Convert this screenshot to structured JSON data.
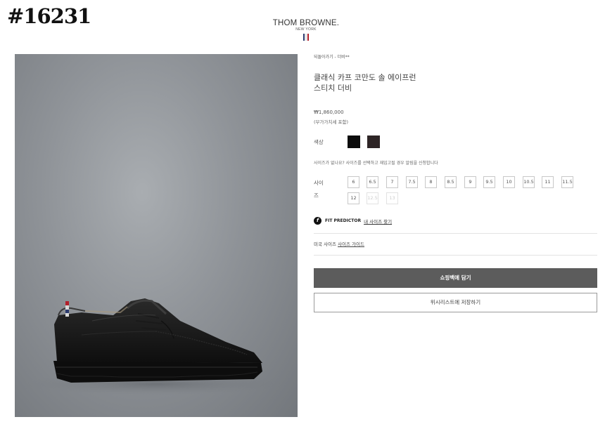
{
  "watermark": "#16231",
  "header": {
    "brand_name": "THOM BROWNE.",
    "brand_sub": "NEW YORK",
    "flag_colors": [
      "#2b3a6e",
      "#ffffff",
      "#b2202b"
    ]
  },
  "breadcrumb": "되돌아가기 - 더비**",
  "product": {
    "title_line1": "클래식 카프 코만도 솔 에이프런",
    "title_line2": "스티치 더비",
    "price": "₩1,860,000",
    "tax_note": "(부가가치세 포함)"
  },
  "colors": {
    "label": "색상",
    "swatches": [
      {
        "name": "black",
        "hex": "#0c0c0c"
      },
      {
        "name": "dark-brown",
        "hex": "#2e2526"
      }
    ]
  },
  "size_note": "사이즈가 없나요? 사이즈를 선택하고 재입고될 경우 알림을 신청합니다",
  "sizes": {
    "label": "사이즈",
    "options": [
      {
        "value": "6",
        "available": true
      },
      {
        "value": "6.5",
        "available": true
      },
      {
        "value": "7",
        "available": true
      },
      {
        "value": "7.5",
        "available": true
      },
      {
        "value": "8",
        "available": true
      },
      {
        "value": "8.5",
        "available": true
      },
      {
        "value": "9",
        "available": true
      },
      {
        "value": "9.5",
        "available": true
      },
      {
        "value": "10",
        "available": true
      },
      {
        "value": "10.5",
        "available": true
      },
      {
        "value": "11",
        "available": true
      },
      {
        "value": "11.5",
        "available": true
      },
      {
        "value": "12",
        "available": true
      },
      {
        "value": "12.5",
        "available": false
      },
      {
        "value": "13",
        "available": false
      }
    ]
  },
  "fit_predictor": {
    "icon": "fit-predictor-icon",
    "brand": "FIT PREDICTOR",
    "link": "내 사이즈 찾기"
  },
  "size_guide": {
    "prefix": "미국 사이즈",
    "link": "사이즈 가이드"
  },
  "buttons": {
    "add_to_bag": "쇼핑백에 담기",
    "wishlist": "위시리스트에 저장하기"
  }
}
